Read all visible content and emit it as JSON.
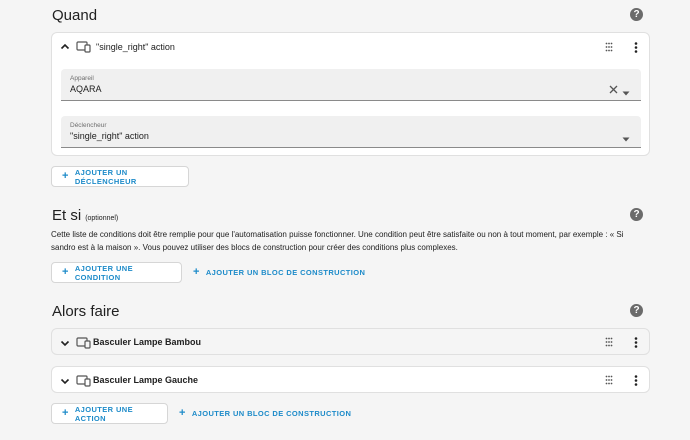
{
  "when": {
    "title": "Quand",
    "trigger": {
      "title": "\"single_right\" action",
      "device_label": "Appareil",
      "device_value": "AQARA",
      "trigger_label": "Déclencheur",
      "trigger_value": "\"single_right\" action"
    },
    "add_trigger": "AJOUTER UN DÉCLENCHEUR"
  },
  "if": {
    "title": "Et si",
    "subtitle": "(optionnel)",
    "description": "Cette liste de conditions doit être remplie pour que l'automatisation puisse fonctionner. Une condition peut être satisfaite ou non à tout moment, par exemple : « Si sandro est à la maison ». Vous pouvez utiliser des blocs de construction pour créer des conditions plus complexes.",
    "add_condition": "AJOUTER UNE CONDITION",
    "add_block": "AJOUTER UN BLOC DE CONSTRUCTION"
  },
  "then": {
    "title": "Alors faire",
    "actions": [
      {
        "title": "Basculer Lampe Bambou"
      },
      {
        "title": "Basculer Lampe Gauche"
      }
    ],
    "add_action": "AJOUTER UNE ACTION",
    "add_block": "AJOUTER UN BLOC DE CONSTRUCTION"
  },
  "icons": {
    "help": "help-circle-icon",
    "device": "device-icon",
    "drag": "drag-grip-icon",
    "menu": "kebab-menu-icon",
    "expand": "chevron-icon",
    "clear": "clear-x-icon",
    "dropdown": "dropdown-arrow-icon",
    "add": "plus-icon"
  },
  "colors": {
    "accent": "#1d8bc9",
    "background": "#f5f5f5",
    "card": "#ffffff"
  }
}
